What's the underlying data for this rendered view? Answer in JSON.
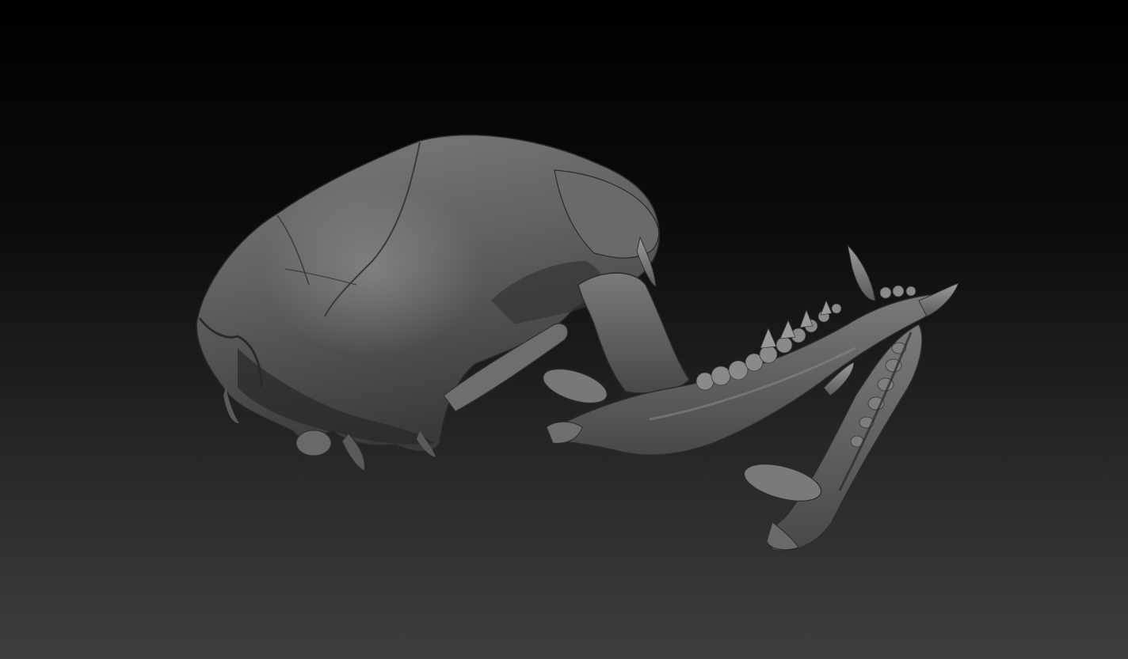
{
  "scene": {
    "subject_icon": "skull-render-icon",
    "background_top": "#000000",
    "background_mid": "#1b1b1b",
    "background_bottom": "#3d3d3d",
    "bone_light": "#8a8a8a",
    "bone_mid": "#5e5e5e",
    "bone_dark": "#2e2e2e"
  }
}
